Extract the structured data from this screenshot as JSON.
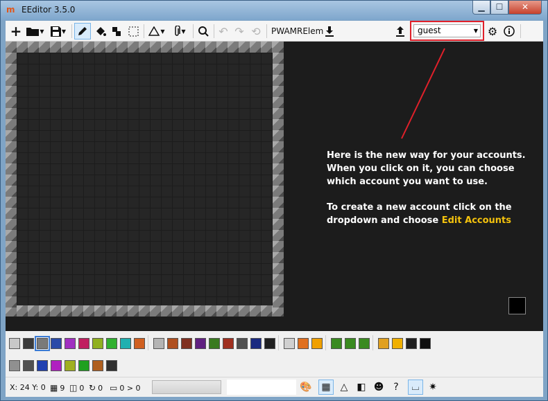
{
  "window": {
    "title": "EEditor 3.5.0",
    "app_icon": "EE",
    "minimize": "▁",
    "maximize": "☐",
    "close": "✕"
  },
  "toolbar": {
    "new_glyph": "+",
    "room_name": "PWAMRElem",
    "account": {
      "selected": "guest",
      "options": [
        "guest"
      ]
    },
    "icons": [
      "new-icon",
      "open-folder-icon",
      "save-icon",
      "pencil-icon",
      "fill-bucket-icon",
      "stamp-icon",
      "fill-region-icon",
      "select-icon",
      "shapes-icon",
      "attachment-icon",
      "replace-icon",
      "undo-icon",
      "redo-icon",
      "history-icon",
      "download-icon",
      "upload-icon",
      "settings-icon",
      "info-icon"
    ]
  },
  "annotation": {
    "line1": "Here is the new way for your accounts.",
    "line2": "When you click on it, you can choose",
    "line3": "which account you want to use.",
    "line4": "To create a new account click on the",
    "line5": "dropdown and choose",
    "line5_highlight": "Edit Accounts",
    "arrow_color": "#e0202a",
    "highlight_color": "#f4c20d"
  },
  "palette": {
    "row1_group1": [
      "#c8c8c8",
      "#3a3a3a",
      "#7a7a7a",
      "#2a4aa8",
      "#a030c0",
      "#c02060",
      "#90b020",
      "#30b030",
      "#20b0b0",
      "#d06020"
    ],
    "row1_group2": [
      "#b4b4b4",
      "#b05020",
      "#803020",
      "#602080",
      "#3a7a20",
      "#a03020",
      "#505050",
      "#1a2a80",
      "#202020"
    ],
    "row1_group3": [
      "#d0d0d0",
      "#e07020",
      "#f0a000"
    ],
    "row1_group4": [
      "#3a8a20",
      "#3a8a20",
      "#3a8a20"
    ],
    "row1_group5": [
      "#e0a020",
      "#f0b000",
      "#202020",
      "#101010"
    ],
    "row2": [
      "#909090",
      "#505050",
      "#2040b0",
      "#b020c0",
      "#a0b020",
      "#20a020",
      "#b06020",
      "#303030"
    ]
  },
  "status": {
    "coords": "X: 24 Y: 0",
    "count_blocks": "9",
    "count_portals": "0",
    "count_rotations": "0",
    "count_labels": "0 > 0"
  }
}
